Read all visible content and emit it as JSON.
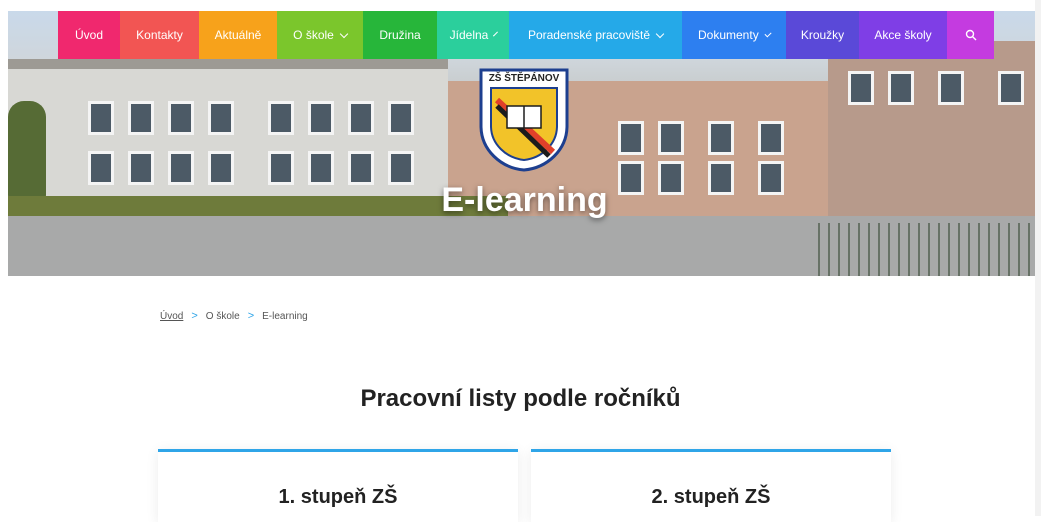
{
  "nav": [
    {
      "label": "Úvod",
      "color": "#f0286e",
      "dropdown": false,
      "w": 62
    },
    {
      "label": "Kontakty",
      "color": "#f25553",
      "dropdown": false,
      "w": 79
    },
    {
      "label": "Aktuálně",
      "color": "#f7a21b",
      "dropdown": false,
      "w": 78
    },
    {
      "label": "O škole",
      "color": "#7bc62c",
      "dropdown": true,
      "w": 86
    },
    {
      "label": "Družina",
      "color": "#27b63a",
      "dropdown": false,
      "w": 74
    },
    {
      "label": "Jídelna",
      "color": "#2bcf9c",
      "dropdown": true,
      "w": 72
    },
    {
      "label": "Poradenské pracoviště",
      "color": "#25a9e8",
      "dropdown": true,
      "w": 173
    },
    {
      "label": "Dokumenty",
      "color": "#2d7ff0",
      "dropdown": true,
      "w": 104
    },
    {
      "label": "Kroužky",
      "color": "#5a49d8",
      "dropdown": false,
      "w": 73
    },
    {
      "label": "Akce školy",
      "color": "#7f3ee6",
      "dropdown": false,
      "w": 88
    },
    {
      "label": "search-icon",
      "color": "#c43be0",
      "dropdown": false,
      "w": 47,
      "icon": true
    }
  ],
  "hero": {
    "title": "E-learning",
    "logo_text": "ZŠ ŠTĚPÁNOV"
  },
  "breadcrumb": {
    "home": "Úvod",
    "level1": "O škole",
    "current": "E-learning",
    "separator": ">"
  },
  "section": {
    "title": "Pracovní listy podle ročníků"
  },
  "cards": [
    {
      "title": "1. stupeň ZŠ"
    },
    {
      "title": "2. stupeň ZŠ"
    }
  ],
  "accent": "#2fa5e8"
}
